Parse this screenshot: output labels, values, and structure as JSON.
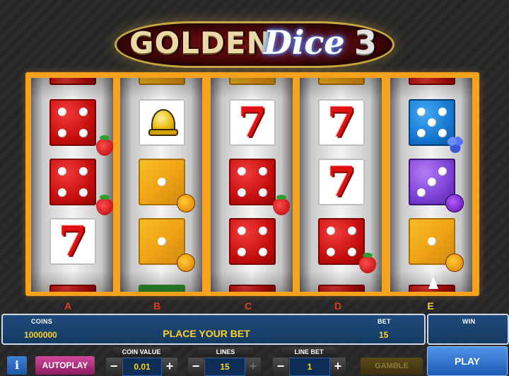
{
  "logo": {
    "word1": "GOLDEN",
    "word2": "Dice",
    "word3": "3"
  },
  "reels": {
    "letters": [
      "A",
      "B",
      "C",
      "D",
      "E"
    ]
  },
  "info": {
    "coins_label": "COINS",
    "coins_value": "1000000",
    "message": "PLACE YOUR BET",
    "bet_label": "BET",
    "bet_value": "15",
    "win_label": "WIN",
    "win_value": ""
  },
  "controls": {
    "info_label": "i",
    "autoplay_label": "AUTOPLAY",
    "coin_value_label": "COIN VALUE",
    "coin_value": "0.01",
    "lines_label": "LINES",
    "lines_value": "15",
    "line_bet_label": "LINE BET",
    "line_bet_value": "1",
    "minus": "−",
    "plus": "+",
    "gamble_label": "GAMBLE",
    "play_label": "PLAY"
  },
  "colors": {
    "frame": "#f6a21d",
    "panel": "#1f4a7a",
    "value_text": "#ffd21f",
    "autoplay": "#b8307f",
    "play": "#3a7fd8"
  }
}
